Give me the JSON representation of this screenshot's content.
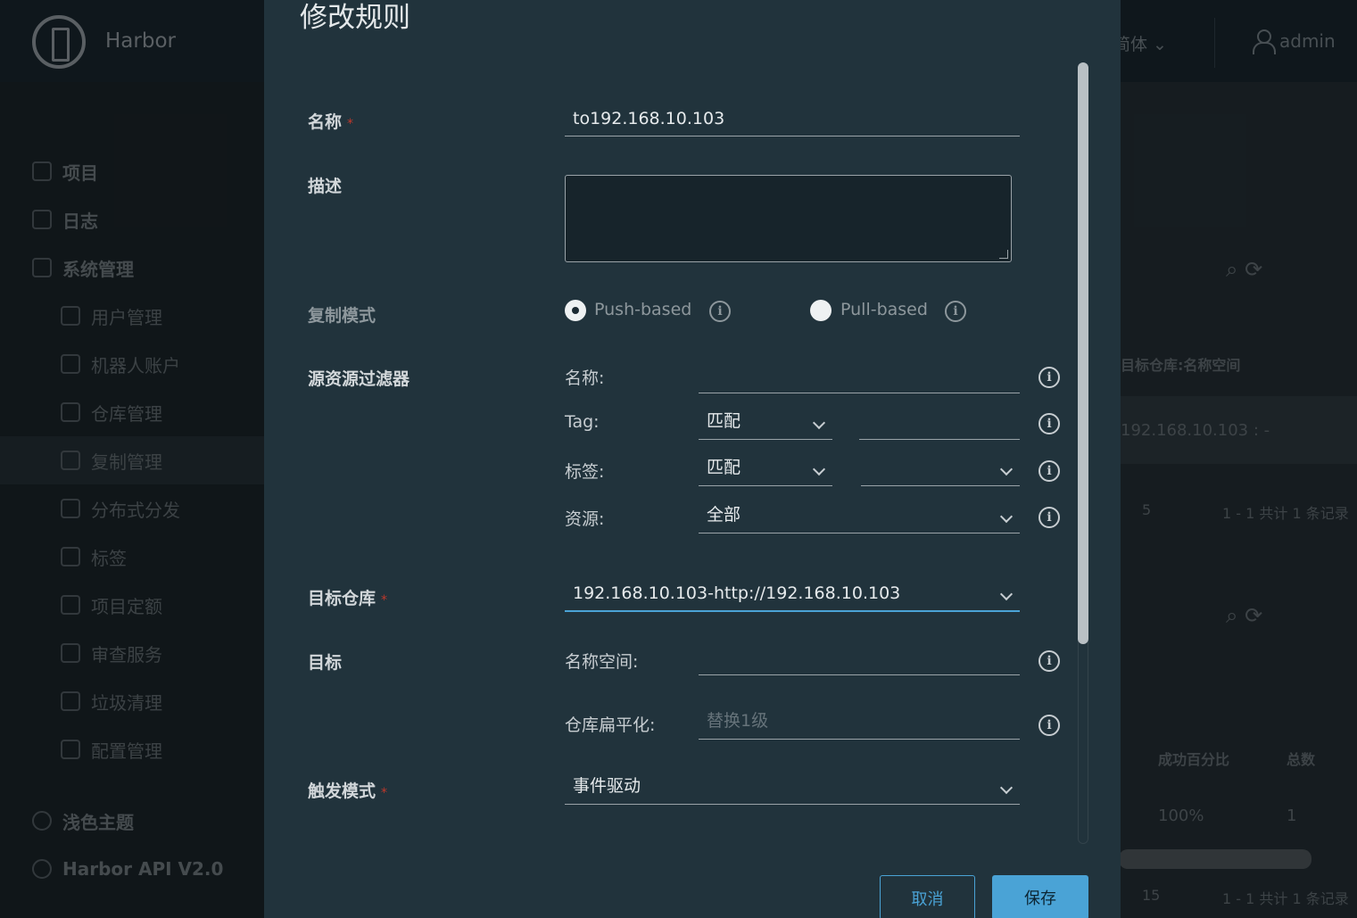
{
  "app": {
    "brand": "Harbor",
    "language": "简体",
    "user": "admin"
  },
  "sidebar": {
    "items": [
      {
        "label": "项目",
        "icon": "projects-icon"
      },
      {
        "label": "日志",
        "icon": "logs-icon"
      },
      {
        "label": "系统管理",
        "icon": "admin-icon"
      }
    ],
    "sub_items": [
      {
        "label": "用户管理",
        "icon": "users-icon"
      },
      {
        "label": "机器人账户",
        "icon": "robot-icon"
      },
      {
        "label": "仓库管理",
        "icon": "registry-icon"
      },
      {
        "label": "复制管理",
        "icon": "replication-icon"
      },
      {
        "label": "分布式分发",
        "icon": "share-icon"
      },
      {
        "label": "标签",
        "icon": "tag-icon"
      },
      {
        "label": "项目定额",
        "icon": "quota-icon"
      },
      {
        "label": "审查服务",
        "icon": "shield-icon"
      },
      {
        "label": "垃圾清理",
        "icon": "trash-icon"
      },
      {
        "label": "配置管理",
        "icon": "gear-icon"
      }
    ],
    "theme": "浅色主题",
    "api": "Harbor API V2.0"
  },
  "background": {
    "col_target": "目标仓库:名称空间",
    "row_target": "192.168.10.103 : -",
    "page_size_1": "5",
    "pagination_1": "1 - 1 共计 1 条记录",
    "col_success": "成功百分比",
    "col_total": "总数",
    "row_success": "100%",
    "row_total": "1",
    "page_size_2": "15",
    "pagination_2": "1 - 1 共计 1 条记录"
  },
  "modal": {
    "title": "修改规则",
    "name_label": "名称",
    "name_value": "to192.168.10.103",
    "desc_label": "描述",
    "desc_value": "",
    "mode_label": "复制模式",
    "mode_push": "Push-based",
    "mode_pull": "Pull-based",
    "filter_label": "源资源过滤器",
    "filter_name_label": "名称:",
    "filter_tag_label": "Tag:",
    "filter_tag_match": "匹配",
    "filter_label_label": "标签:",
    "filter_label_match": "匹配",
    "filter_resource_label": "资源:",
    "filter_resource_value": "全部",
    "target_registry_label": "目标仓库",
    "target_registry_value": "192.168.10.103-http://192.168.10.103",
    "target_label": "目标",
    "namespace_label": "名称空间:",
    "flatten_label": "仓库扁平化:",
    "flatten_placeholder": "替换1级",
    "trigger_label": "触发模式",
    "trigger_value": "事件驱动",
    "cancel": "取消",
    "save": "保存"
  }
}
